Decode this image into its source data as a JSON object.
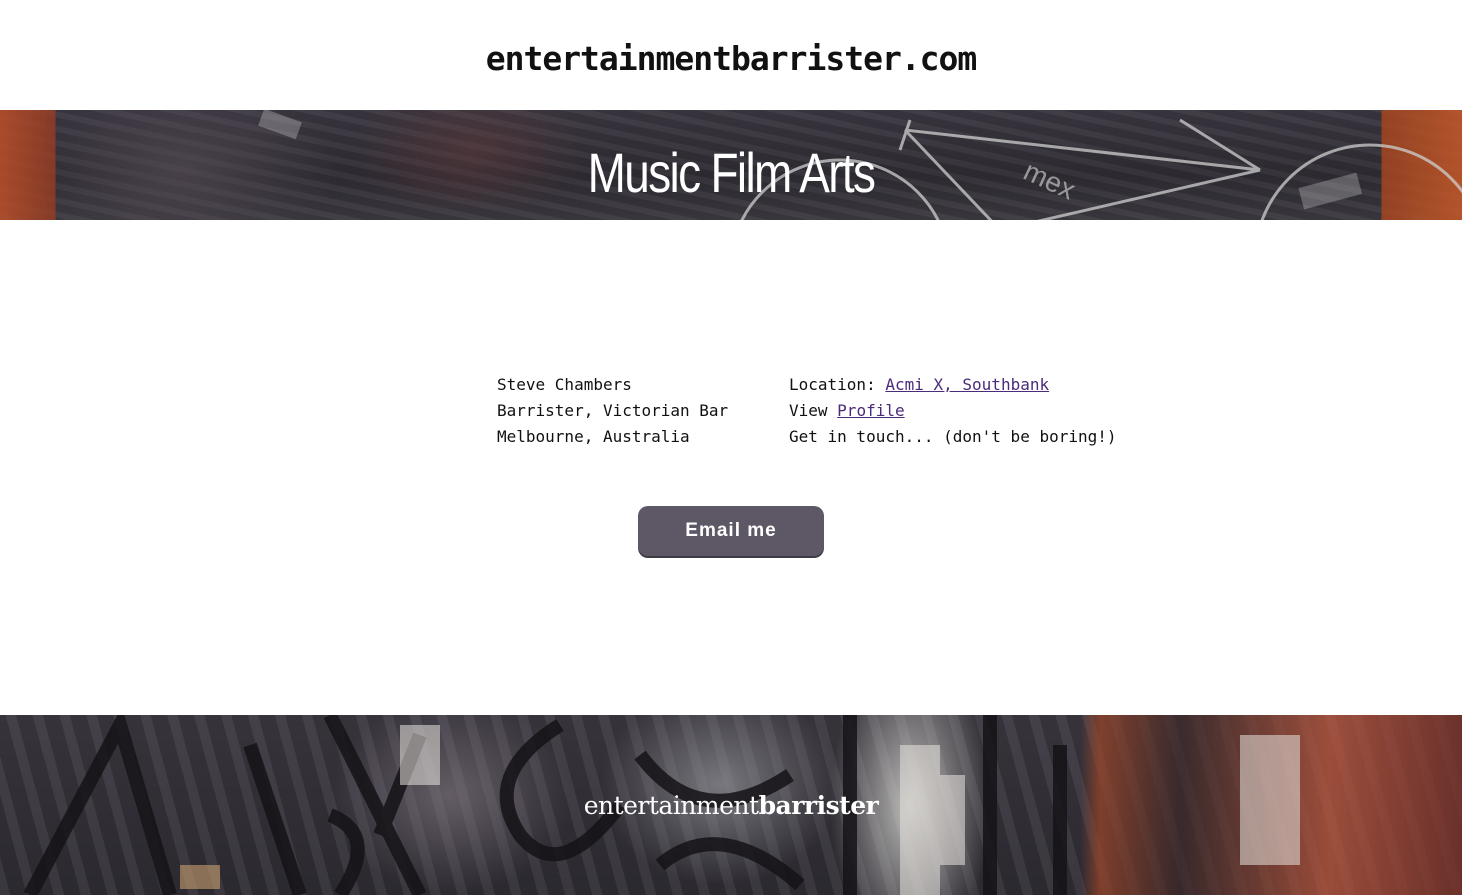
{
  "header": {
    "title": "entertainmentbarrister.com"
  },
  "hero": {
    "title": "Music Film Arts"
  },
  "contact": {
    "name": "Steve Chambers",
    "role": "Barrister, Victorian Bar",
    "city": "Melbourne, Australia",
    "location_label": "Location:",
    "location_link": "Acmi X, Southbank",
    "view_label": "View",
    "profile_link": "Profile",
    "touch_text": "Get in touch... (don't be boring!)"
  },
  "cta": {
    "email_label": "Email me"
  },
  "footer": {
    "logo_light": "entertainment",
    "logo_bold": "barrister"
  },
  "colors": {
    "button": "#5e5766",
    "link": "#4b2a7a"
  }
}
